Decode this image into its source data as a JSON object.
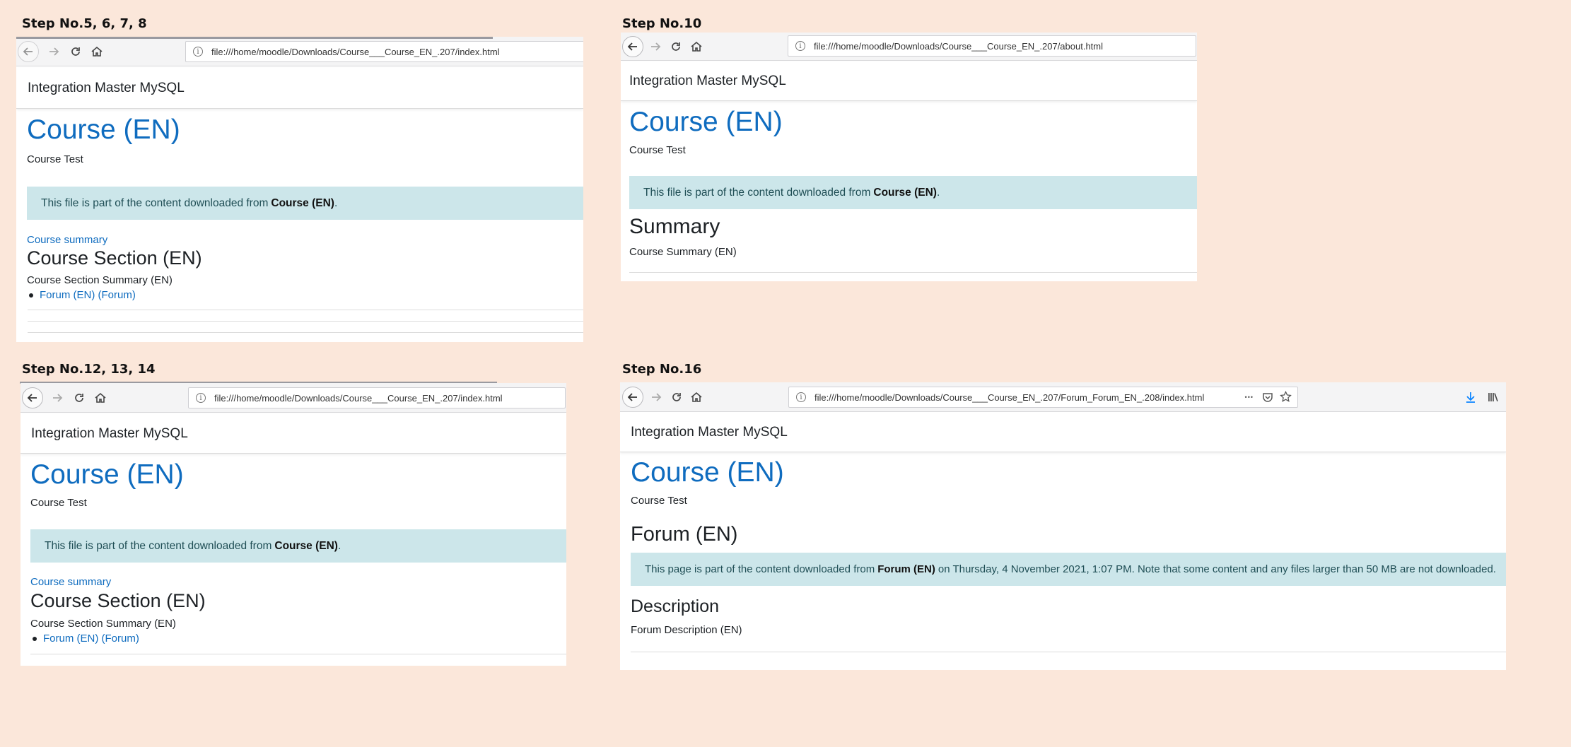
{
  "steps": [
    {
      "label": "Step No.5, 6, 7, 8",
      "url": "file:///home/moodle/Downloads/Course___Course_EN_.207/index.html",
      "site_name": "Integration Master MySQL",
      "course_title": "Course (EN)",
      "course_sub": "Course Test",
      "alert_pre": "This file is part of the content downloaded from ",
      "alert_bold": "Course (EN)",
      "alert_post": ".",
      "summary_link": "Course summary",
      "section_title": "Course Section (EN)",
      "section_summary": "Course Section Summary (EN)",
      "forum_link": "Forum (EN) (Forum)"
    },
    {
      "label": "Step No.10",
      "url": "file:///home/moodle/Downloads/Course___Course_EN_.207/about.html",
      "site_name": "Integration Master MySQL",
      "course_title": "Course (EN)",
      "course_sub": "Course Test",
      "alert_pre": "This file is part of the content downloaded from ",
      "alert_bold": "Course (EN)",
      "alert_post": ".",
      "summary_title": "Summary",
      "summary_text": "Course Summary (EN)"
    },
    {
      "label": "Step No.12, 13, 14",
      "url": "file:///home/moodle/Downloads/Course___Course_EN_.207/index.html",
      "site_name": "Integration Master MySQL",
      "course_title": "Course (EN)",
      "course_sub": "Course Test",
      "alert_pre": "This file is part of the content downloaded from ",
      "alert_bold": "Course (EN)",
      "alert_post": ".",
      "summary_link": "Course summary",
      "section_title": "Course Section (EN)",
      "section_summary": "Course Section Summary (EN)",
      "forum_link": "Forum (EN) (Forum)"
    },
    {
      "label": "Step No.16",
      "url": "file:///home/moodle/Downloads/Course___Course_EN_.207/Forum_Forum_EN_.208/index.html",
      "site_name": "Integration Master MySQL",
      "course_title": "Course (EN)",
      "course_sub": "Course Test",
      "forum_title": "Forum (EN)",
      "alert_pre": "This page is part of the content downloaded from ",
      "alert_bold": "Forum (EN)",
      "alert_post": " on Thursday, 4 November 2021, 1:07 PM. Note that some content and any files larger than 50 MB are not downloaded.",
      "description_title": "Description",
      "description_text": "Forum Description (EN)",
      "more_icon": "•••"
    }
  ],
  "colors": {
    "background": "#fbe7da",
    "link": "#0f6cbf",
    "alert_bg": "#cce6ea",
    "download_icon": "#0a84ff"
  }
}
